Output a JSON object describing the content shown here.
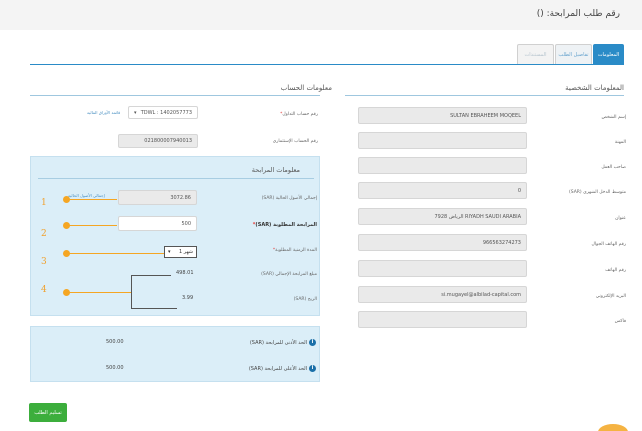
{
  "header": {
    "title": "رقم طلب المرابحة: ()"
  },
  "tabs": [
    {
      "label": "المعلومات",
      "state": "active"
    },
    {
      "label": "تفاصيل الطلب",
      "state": "inactive"
    },
    {
      "label": "المستندات",
      "state": "disabled"
    }
  ],
  "personal": {
    "title": "المعلومات الشخصية",
    "fields": [
      {
        "label": "إسم الشخص",
        "value": "SULTAN EBRAHEEM MOQEEL"
      },
      {
        "label": "المهنة",
        "value": ""
      },
      {
        "label": "صاحب العمل",
        "value": ""
      },
      {
        "label": "متوسط الدخل الشهري (SAR)",
        "value": "0"
      },
      {
        "label": "عنوان",
        "value": "7928 الرياض RIYADH SAUDI ARABIA"
      },
      {
        "label": "رقم الهاتف الجوال",
        "value": "966563274273"
      },
      {
        "label": "رقم الهاتف",
        "value": ""
      },
      {
        "label": "البريد الإلكتروني",
        "value": "si.mugayel@albilad-capital.com"
      },
      {
        "label": "فاكس",
        "value": ""
      }
    ]
  },
  "account": {
    "title": "معلومات الحساب",
    "account_no_label": "رقم حساب التداول",
    "account_no_value": "TDWL : 1402057773",
    "account_link": "قائمة الأوراق المالية",
    "investment_label": "رقم الحساب الإستثماري",
    "investment_value": "021800007940013"
  },
  "murabaha": {
    "title": "معلومات المرابحة",
    "total_assets_label": "إجمالي الأصول الحالية (SAR)",
    "total_assets_value": "3072.86",
    "total_assets_link": "إجمالي الأصول الحالية",
    "requested_label": "المرابحة المطلوبة (SAR)",
    "requested_value": "500",
    "duration_label": "المدة الزمنية المطلوبة",
    "duration_value": "1 شهر",
    "total_amount_label": "مبلغ المرابحة الإجمالي (SAR)",
    "total_amount_value": "498.01",
    "profit_label": "الربح (SAR)",
    "profit_value": "3.99",
    "steps": [
      "1",
      "2",
      "3",
      "4"
    ]
  },
  "limits": {
    "min_label": "الحد الأدنى للمرابحة (SAR)",
    "min_value": "500.00",
    "max_label": "الحد الأعلى للمرابحة (SAR)",
    "max_value": "500.00",
    "icon": "i"
  },
  "submit_label": "تسليم الطلب",
  "colors": {
    "accent": "#2a8bc7",
    "step": "#f5a623",
    "submit": "#3cae3c"
  }
}
